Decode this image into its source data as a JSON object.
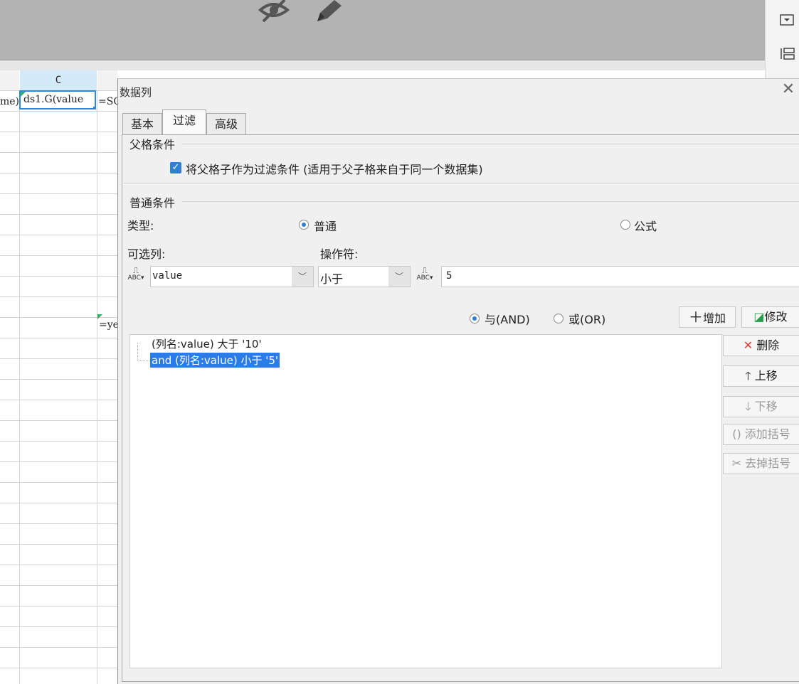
{
  "spreadsheet": {
    "column_c_label": "C",
    "cell_b1_fragment": "me)",
    "cell_c1_value": "ds1.G(value",
    "cell_d1_fragment": "=SQ",
    "cell_d13_fragment": "=ye"
  },
  "toolbar": {
    "icons": [
      "eye-slash-icon",
      "pencil-icon"
    ],
    "right_icons": [
      "dropdown-box-icon",
      "layout-icon"
    ]
  },
  "dialog": {
    "title": "数据列",
    "close_glyph": "✕",
    "tabs": [
      "基本",
      "过滤",
      "高级"
    ],
    "active_tab": "过滤",
    "parent_group_title": "父格条件",
    "parent_checkbox_label": "将父格子作为过滤条件 (适用于父子格来自于同一个数据集)",
    "parent_checkbox_checked": true,
    "normal_group_title": "普通条件",
    "type_label": "类型:",
    "type_options": [
      "普通",
      "公式"
    ],
    "type_selected": "普通",
    "column_label": "可选列:",
    "operator_label": "操作符:",
    "column_value": "value",
    "operator_value": "小于",
    "condition_value": "5",
    "logic_options": [
      "与(AND)",
      "或(OR)"
    ],
    "logic_selected": "与(AND)",
    "add_button": "增加",
    "modify_button": "修改",
    "conditions": [
      "(列名:value) 大于 '10'",
      "and (列名:value) 小于 '5'"
    ],
    "selected_condition_index": 1,
    "side_buttons": [
      {
        "label": "删除",
        "icon": "delete-x-icon",
        "enabled": true
      },
      {
        "label": "上移",
        "icon": "arrow-up-icon",
        "enabled": true
      },
      {
        "label": "下移",
        "icon": "arrow-down-icon",
        "enabled": false
      },
      {
        "label": "添加括号",
        "icon": "add-bracket-icon",
        "enabled": false
      },
      {
        "label": "去掉括号",
        "icon": "remove-bracket-icon",
        "enabled": false
      }
    ]
  }
}
